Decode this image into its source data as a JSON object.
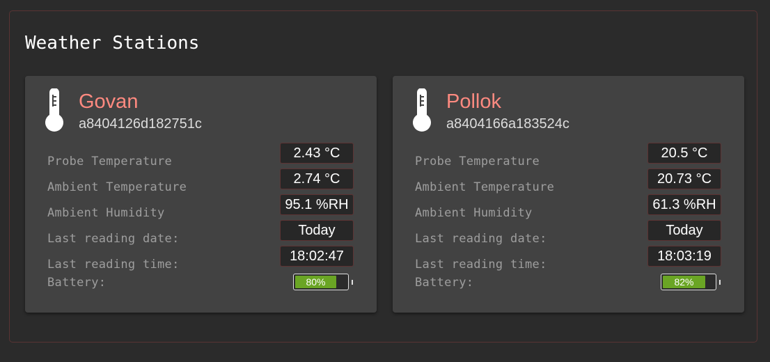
{
  "panel": {
    "title": "Weather Stations"
  },
  "stations": [
    {
      "name": "Govan",
      "id": "a8404126d182751c",
      "icon": "thermometer-icon",
      "rows": [
        {
          "label": "Probe Temperature",
          "value": "2.43 °C"
        },
        {
          "label": "Ambient Temperature",
          "value": "2.74 °C"
        },
        {
          "label": "Ambient Humidity",
          "value": "95.1 %RH"
        },
        {
          "label": "Last reading date:",
          "value": "Today"
        },
        {
          "label": "Last reading time:",
          "value": "18:02:47"
        }
      ],
      "battery": {
        "label": "Battery:",
        "level": 0.8,
        "text": "80%"
      }
    },
    {
      "name": "Pollok",
      "id": "a8404166a183524c",
      "icon": "thermometer-icon",
      "rows": [
        {
          "label": "Probe Temperature",
          "value": "20.5 °C"
        },
        {
          "label": "Ambient Temperature",
          "value": "20.73 °C"
        },
        {
          "label": "Ambient Humidity",
          "value": "61.3 %RH"
        },
        {
          "label": "Last reading date:",
          "value": "Today"
        },
        {
          "label": "Last reading time:",
          "value": "18:03:19"
        }
      ],
      "battery": {
        "label": "Battery:",
        "level": 0.82,
        "text": "82%"
      }
    }
  ],
  "colors": {
    "accent": "#ff8a80",
    "battery_fill": "#6aa524",
    "value_border": "#5d3333",
    "card_bg": "#424242"
  }
}
